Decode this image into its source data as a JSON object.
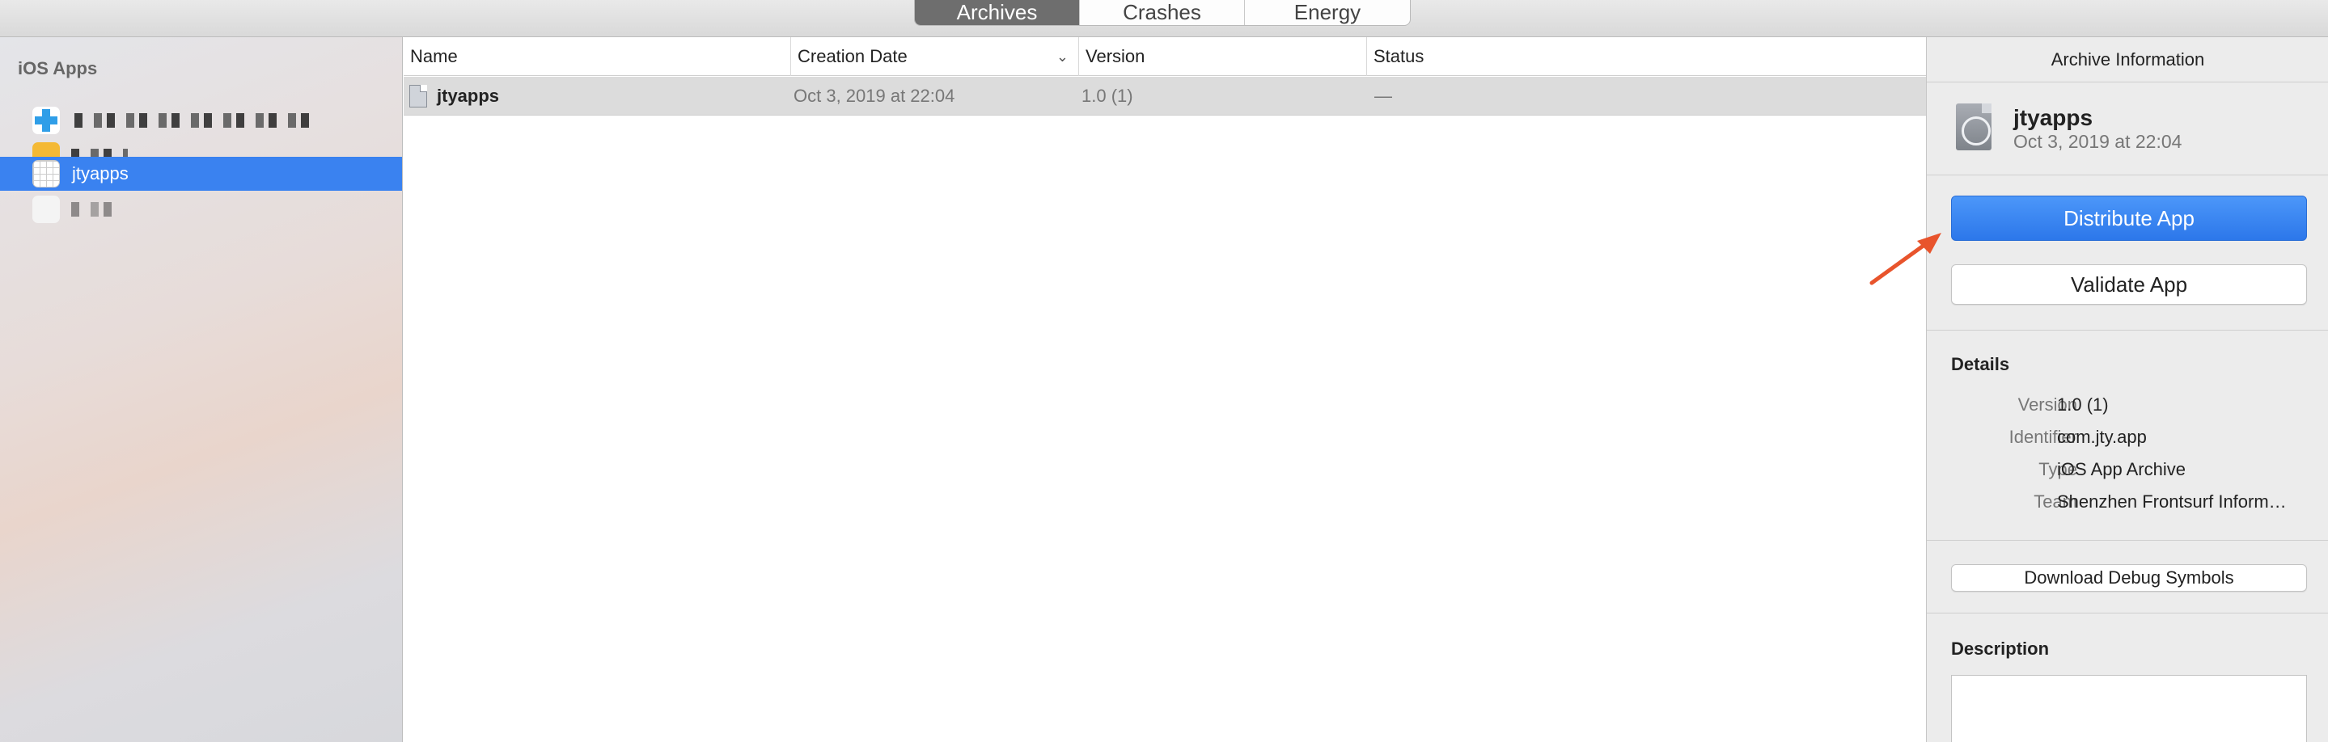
{
  "toolbar": {
    "tabs": [
      {
        "label": "Archives",
        "active": true
      },
      {
        "label": "Crashes",
        "active": false
      },
      {
        "label": "Energy",
        "active": false
      }
    ]
  },
  "sidebar": {
    "heading": "iOS Apps",
    "items": [
      {
        "label": "",
        "icon": "blue-cross-app-icon",
        "selected": false
      },
      {
        "label": "",
        "icon": "yellow-app-icon",
        "selected": false
      },
      {
        "label": "jtyapps",
        "icon": "grid-app-icon",
        "selected": true
      },
      {
        "label": "",
        "icon": "white-app-icon",
        "selected": false
      }
    ]
  },
  "table": {
    "columns": [
      "Name",
      "Creation Date",
      "Version",
      "Status"
    ],
    "sort_indicator": "⌄",
    "rows": [
      {
        "name": "jtyapps",
        "date": "Oct 3, 2019 at 22:04",
        "version": "1.0 (1)",
        "status": "—"
      }
    ]
  },
  "inspector": {
    "title": "Archive Information",
    "archive_name": "jtyapps",
    "archive_date": "Oct 3, 2019 at 22:04",
    "distribute_label": "Distribute App",
    "validate_label": "Validate App",
    "details_heading": "Details",
    "details": [
      {
        "key": "Version",
        "value": "1.0 (1)"
      },
      {
        "key": "Identifier",
        "value": "com.jty.app"
      },
      {
        "key": "Type",
        "value": "iOS App Archive"
      },
      {
        "key": "Team",
        "value": "Shenzhen Frontsurf Inform…"
      }
    ],
    "download_symbols_label": "Download Debug Symbols",
    "description_heading": "Description"
  },
  "colors": {
    "accent": "#3a82f0",
    "arrow": "#e8542c"
  }
}
